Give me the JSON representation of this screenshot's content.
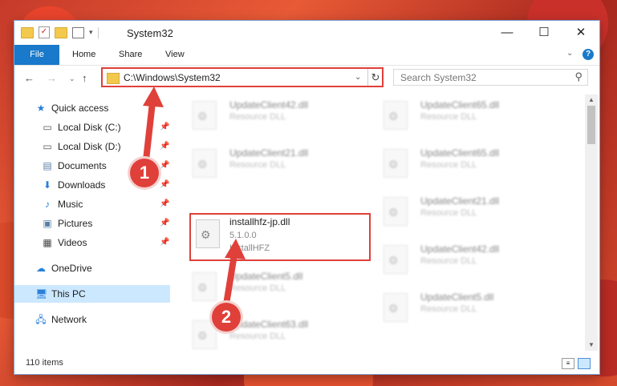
{
  "window": {
    "title": "System32",
    "controls": {
      "minimize": "—",
      "maximize": "☐",
      "close": "✕"
    }
  },
  "ribbon": {
    "tabs": [
      "File",
      "Home",
      "Share",
      "View"
    ]
  },
  "address": {
    "path": "C:\\Windows\\System32",
    "search_placeholder": "Search System32"
  },
  "nav_pane": {
    "items": [
      {
        "label": "Quick access",
        "icon": "star-icon",
        "pinned": false
      },
      {
        "label": "Local Disk (C:)",
        "icon": "drive-icon",
        "pinned": true
      },
      {
        "label": "Local Disk (D:)",
        "icon": "drive-icon",
        "pinned": true
      },
      {
        "label": "Documents",
        "icon": "documents-icon",
        "pinned": true
      },
      {
        "label": "Downloads",
        "icon": "download-icon",
        "pinned": true
      },
      {
        "label": "Music",
        "icon": "music-icon",
        "pinned": true
      },
      {
        "label": "Pictures",
        "icon": "pictures-icon",
        "pinned": true
      },
      {
        "label": "Videos",
        "icon": "videos-icon",
        "pinned": true
      },
      {
        "label": "OneDrive",
        "icon": "cloud-icon",
        "pinned": false
      },
      {
        "label": "This PC",
        "icon": "computer-icon",
        "pinned": false,
        "selected": true
      },
      {
        "label": "Network",
        "icon": "network-icon",
        "pinned": false
      }
    ]
  },
  "files": {
    "left": [
      {
        "name": "UpdateClient42.dll",
        "line2": "Resource DLL",
        "line3": ""
      },
      {
        "name": "UpdateClient21.dll",
        "line2": "Resource DLL",
        "line3": ""
      },
      {
        "name": "installhfz-jp.dll",
        "line2": "5.1.0.0",
        "line3": "InstallHFZ"
      },
      {
        "name": "UpdateClient5.dll",
        "line2": "Resource DLL",
        "line3": ""
      },
      {
        "name": "UpdateClient63.dll",
        "line2": "Resource DLL",
        "line3": ""
      }
    ],
    "right": [
      {
        "name": "UpdateClient65.dll",
        "line2": "Resource DLL"
      },
      {
        "name": "UpdateClient65.dll",
        "line2": "Resource DLL"
      },
      {
        "name": "UpdateClient21.dll",
        "line2": "Resource DLL"
      },
      {
        "name": "UpdateClient42.dll",
        "line2": "Resource DLL"
      },
      {
        "name": "UpdateClient5.dll",
        "line2": "Resource DLL"
      }
    ]
  },
  "status": {
    "item_count": "110 items"
  },
  "annotations": {
    "step1": "1",
    "step2": "2",
    "color": "#e0403a"
  }
}
